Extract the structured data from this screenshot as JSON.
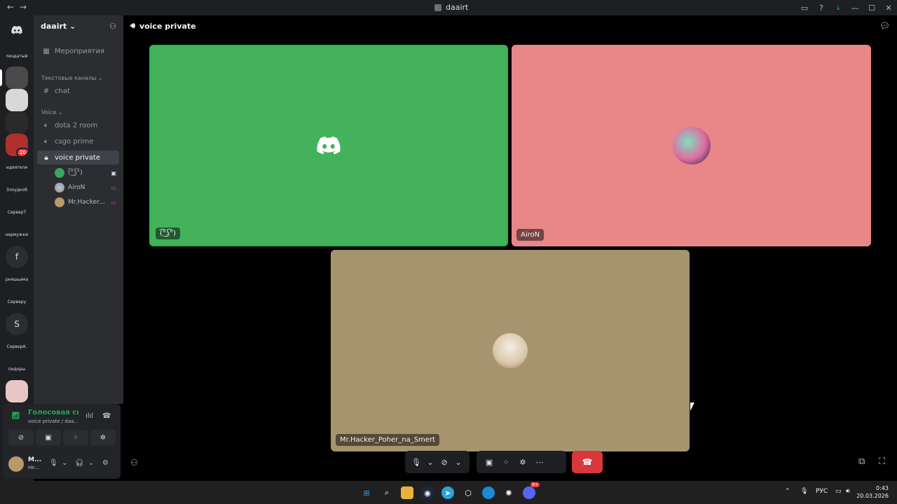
{
  "titlebar": {
    "title": "daairt"
  },
  "guilds": {
    "items": [
      {
        "label": "пиздатый",
        "kind": "text"
      },
      {
        "label": "",
        "kind": "avatar",
        "color": "#4a4a4a"
      },
      {
        "label": "",
        "kind": "avatar",
        "color": "#d8d8d8"
      },
      {
        "label": "",
        "kind": "avatar",
        "color": "#2a2a2a"
      },
      {
        "label": "20",
        "kind": "badge",
        "color": "#b03030"
      },
      {
        "label": "идеятели",
        "kind": "text"
      },
      {
        "label": "Злоудкоб",
        "kind": "text"
      },
      {
        "label": "СерверТ",
        "kind": "text"
      },
      {
        "label": "нермужкм",
        "kind": "text"
      },
      {
        "label": "f",
        "kind": "letter"
      },
      {
        "label": "рняшьама",
        "kind": "text"
      },
      {
        "label": "Серверу",
        "kind": "text"
      },
      {
        "label": "S",
        "kind": "letter"
      },
      {
        "label": "СерверА.",
        "kind": "text"
      },
      {
        "label": "пидоры",
        "kind": "text"
      },
      {
        "label": "",
        "kind": "avatar",
        "color": "#e8c6c6"
      }
    ]
  },
  "server": {
    "name": "daairt",
    "events": "Мероприятия"
  },
  "categories": {
    "text": "Текстовые каналы",
    "voice": "Voice"
  },
  "channels": {
    "chat": "chat",
    "dota": "dota 2 room",
    "csgo": "csgo prime",
    "private": "voice private"
  },
  "voice_users": [
    {
      "name": "(͡°͜ʖ͡°)",
      "color": "#3ba55d"
    },
    {
      "name": "AiroN",
      "color": "#c86aa0"
    },
    {
      "name": "Mr.Hacker...",
      "color": "#b89a6a"
    }
  ],
  "voice_panel": {
    "status": "Голосовая связ",
    "sub": "voice private / daa..."
  },
  "user": {
    "name": "M...",
    "status": "He..."
  },
  "call": {
    "title": "voice private",
    "tiles": [
      {
        "name": "(͡°͜ʖ͡°)"
      },
      {
        "name": "AiroN"
      },
      {
        "name": "Mr.Hacker_Poher_na_Smert"
      }
    ]
  },
  "taskbar": {
    "lang": "РУС",
    "time": "0:43",
    "date": "20.03.2026",
    "badge": "9+"
  }
}
